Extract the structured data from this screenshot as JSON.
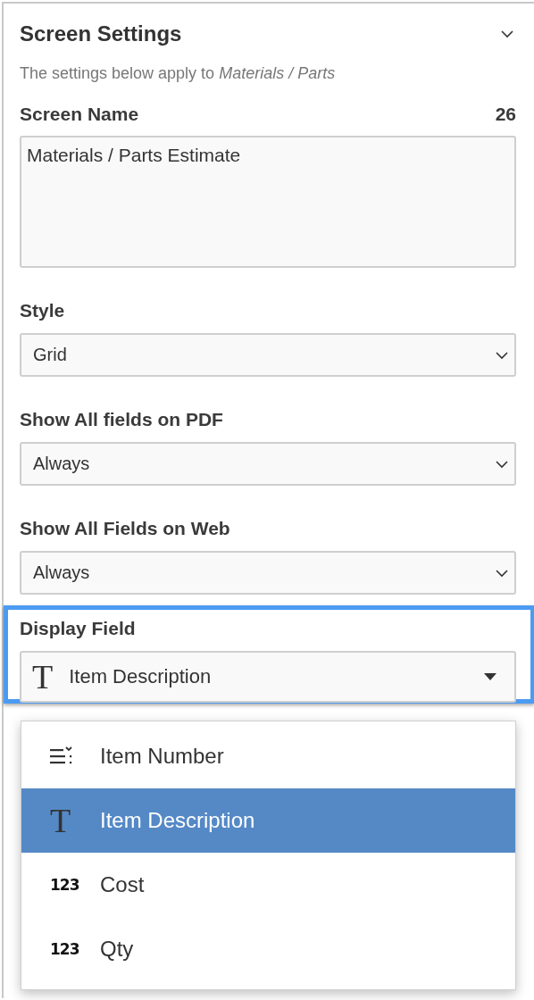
{
  "panel": {
    "title": "Screen Settings",
    "expanded": true,
    "description": "The settings below apply to *Materials / Parts*"
  },
  "screen_name": {
    "label": "Screen Name",
    "count": "26",
    "value": "Materials / Parts Estimate"
  },
  "selects": [
    {
      "label": "Style",
      "value": "Grid"
    },
    {
      "label": "Show All fields on PDF",
      "value": "Always"
    },
    {
      "label": "Show All Fields on Web",
      "value": "Always"
    }
  ],
  "display_field": {
    "label": "Display Field",
    "highlighted": true,
    "value": "Item Description",
    "kind": "text",
    "value_icon": "T",
    "open": true,
    "options": [
      {
        "label": "Item Number",
        "kind": "list",
        "selected": false
      },
      {
        "label": "Item Description",
        "kind": "text",
        "icon": "T",
        "selected": true
      },
      {
        "label": "Cost",
        "kind": "number",
        "icon": "123",
        "selected": false
      },
      {
        "label": "Qty",
        "kind": "number",
        "icon": "123",
        "selected": false
      }
    ]
  }
}
